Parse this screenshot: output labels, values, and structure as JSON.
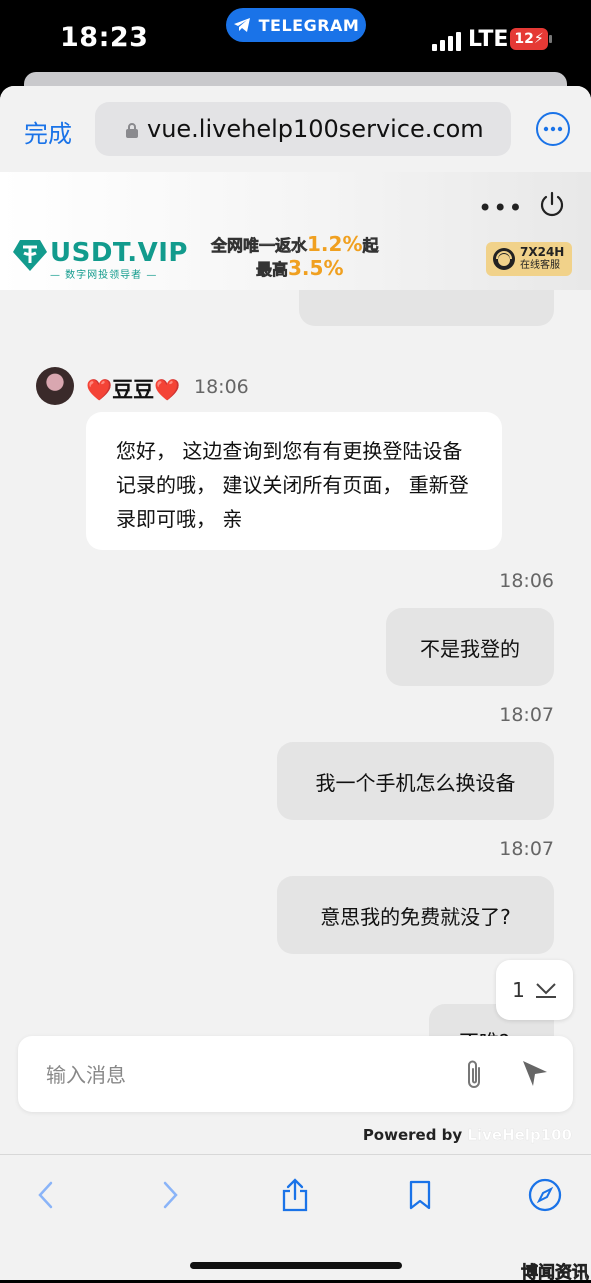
{
  "status_bar": {
    "time": "18:23",
    "app_pill": "TELEGRAM",
    "network": "LTE",
    "battery": "12"
  },
  "browser": {
    "done_label": "完成",
    "url": "vue.livehelp100service.com",
    "more_icon": "ellipsis-circle-icon"
  },
  "page_header": {
    "more_label": "•••",
    "logo_text": "USDT.VIP",
    "logo_subtitle": "— 数字网投领导者 —",
    "promo_line1_prefix": "全网唯一返水",
    "promo_line1_value": "1.2%",
    "promo_line1_suffix": "起",
    "promo_line2_prefix": "最高",
    "promo_line2_value": "3.5%",
    "service_line1": "7X24H",
    "service_line2": "在线客服"
  },
  "chat": {
    "agent": {
      "name": "❤️豆豆❤️",
      "time": "18:06",
      "message": "您好， 这边查询到您有有更换登陆设备记录的哦， 建议关闭所有页面， 重新登录即可哦， 亲"
    },
    "user_messages": [
      {
        "time": "18:06",
        "text": "不是我登的"
      },
      {
        "time": "18:07",
        "text": "我一个手机怎么换设备"
      },
      {
        "time": "18:07",
        "text": "意思我的免费就没了?"
      }
    ],
    "partial_bottom_text": "不唯?",
    "scroll_badge_count": "1"
  },
  "input": {
    "placeholder": "输入消息",
    "value": ""
  },
  "footer": {
    "powered_by": "Powered by",
    "powered_brand": "LiveHelp100"
  },
  "toolbar": {
    "icons": [
      "back-icon",
      "forward-icon",
      "share-icon",
      "bookmarks-icon",
      "compass-icon"
    ]
  },
  "watermark": "博闻资讯",
  "colors": {
    "accent": "#1a73e8",
    "brand_teal": "#129b8d",
    "promo_orange": "#f0a020",
    "user_bubble": "#e4e4e4"
  }
}
